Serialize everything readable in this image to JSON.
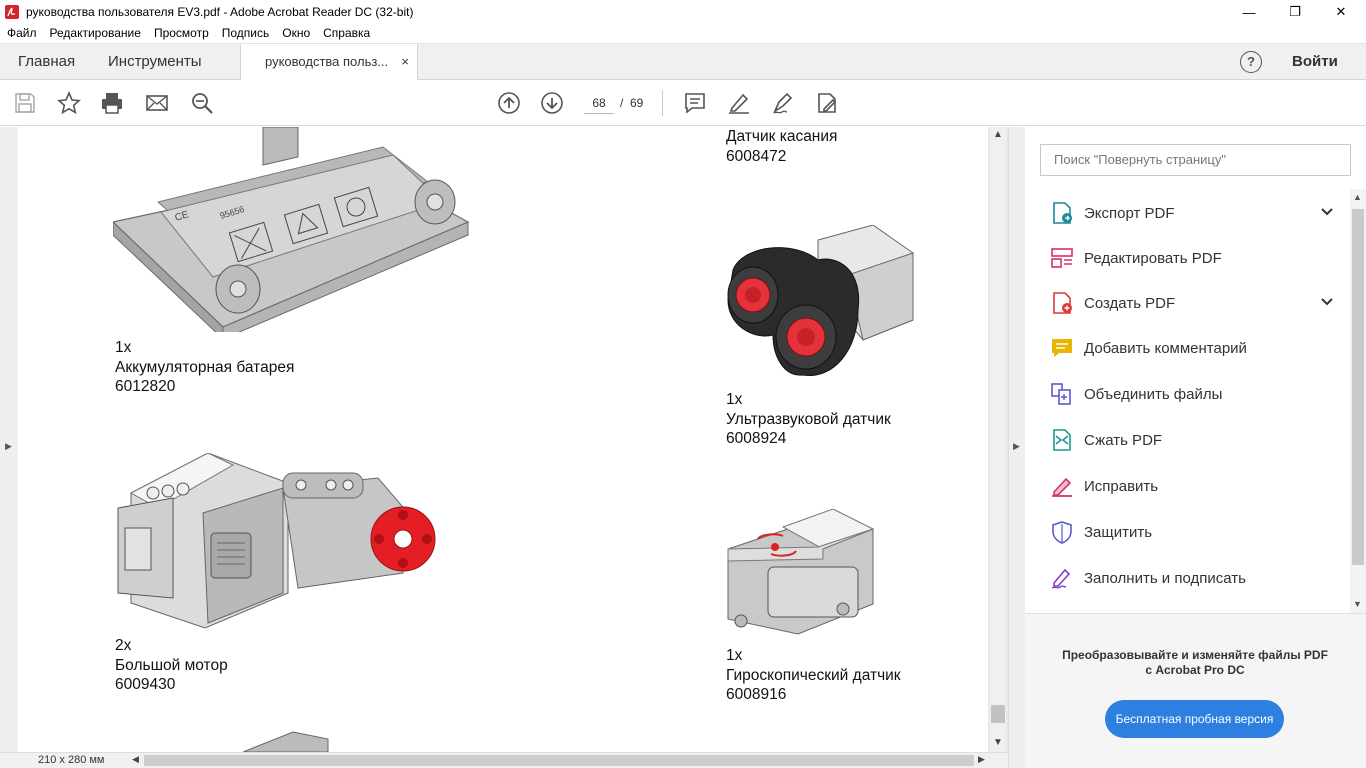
{
  "window": {
    "title": "руководства пользователя EV3.pdf - Adobe Acrobat Reader DC (32-bit)",
    "minimize": "—",
    "restore": "❐",
    "close": "✕"
  },
  "menu": [
    "Файл",
    "Редактирование",
    "Просмотр",
    "Подпись",
    "Окно",
    "Справка"
  ],
  "tabs": {
    "home": "Главная",
    "tools": "Инструменты",
    "document": "руководства польз...",
    "document_close": "×",
    "help": "?",
    "login": "Войти"
  },
  "toolbar": {
    "current_page": "68",
    "page_separator": "/",
    "total_pages": "69"
  },
  "document": {
    "parts": [
      {
        "qty": "",
        "name": "Датчик касания",
        "code": "6008472"
      },
      {
        "qty": "1x",
        "name": "Аккумуляторная батарея",
        "code": "6012820"
      },
      {
        "qty": "1x",
        "name": "Ультразвуковой датчик",
        "code": "6008924"
      },
      {
        "qty": "2x",
        "name": "Большой мотор",
        "code": "6009430"
      },
      {
        "qty": "1x",
        "name": "Гироскопический датчик",
        "code": "6008916"
      }
    ],
    "battery_stamp": "95656",
    "battery_ce": "CE"
  },
  "statusbar": {
    "page_size": "210 x 280 мм"
  },
  "right_panel": {
    "search_placeholder": "Поиск \"Повернуть страницу\"",
    "tools": [
      {
        "label": "Экспорт PDF",
        "icon": "export-pdf-icon",
        "color": "#1a8a9c",
        "expandable": true
      },
      {
        "label": "Редактировать PDF",
        "icon": "edit-pdf-icon",
        "color": "#d6306a",
        "expandable": false
      },
      {
        "label": "Создать PDF",
        "icon": "create-pdf-icon",
        "color": "#d83b3b",
        "expandable": true
      },
      {
        "label": "Добавить комментарий",
        "icon": "comment-icon",
        "color": "#e8b500",
        "expandable": false
      },
      {
        "label": "Объединить файлы",
        "icon": "combine-files-icon",
        "color": "#5a5ad0",
        "expandable": false
      },
      {
        "label": "Сжать PDF",
        "icon": "compress-pdf-icon",
        "color": "#1a9a8a",
        "expandable": false
      },
      {
        "label": "Исправить",
        "icon": "fix-icon",
        "color": "#d6306a",
        "expandable": false
      },
      {
        "label": "Защитить",
        "icon": "protect-icon",
        "color": "#5a5ad0",
        "expandable": false
      },
      {
        "label": "Заполнить и подписать",
        "icon": "fill-sign-icon",
        "color": "#8a3ad0",
        "expandable": false
      }
    ],
    "promo_line1": "Преобразовывайте и изменяйте файлы PDF",
    "promo_line2": "с Acrobat Pro DC",
    "promo_button": "Бесплатная пробная версия"
  }
}
